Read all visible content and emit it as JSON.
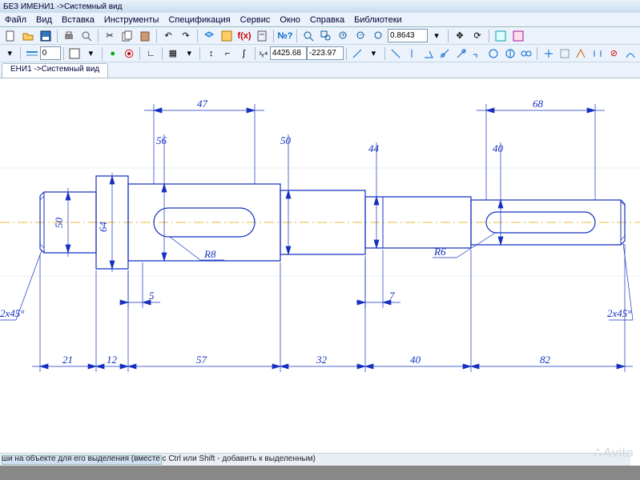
{
  "title": "БЕЗ ИМЕНИ1 ->Системный вид",
  "menu": [
    "Файл",
    "Вид",
    "Вставка",
    "Инструменты",
    "Спецификация",
    "Сервис",
    "Окно",
    "Справка",
    "Библиотеки"
  ],
  "tab": "ЕНИ1 ->Системный вид",
  "zoom": "0.8643",
  "coordX": "4425.68",
  "coordY": "-223.97",
  "styleNum": "0",
  "statusMsg": "ши на объекте для его выделения (вместе с Ctrl или Shift - добавить к выделенным)",
  "dims": {
    "d47": "47",
    "d68": "68",
    "d56": "56",
    "d50v": "50",
    "d44": "44",
    "d40": "40",
    "d50": "50",
    "d64": "64",
    "r8": "R8",
    "r6": "R6",
    "d5": "5",
    "d7": "7",
    "d21": "21",
    "d12": "12",
    "d57": "57",
    "d32": "32",
    "d40b": "40",
    "d82": "82",
    "ch45l": "2x45°",
    "ch45r": "2x45°"
  },
  "watermark": "Avito"
}
